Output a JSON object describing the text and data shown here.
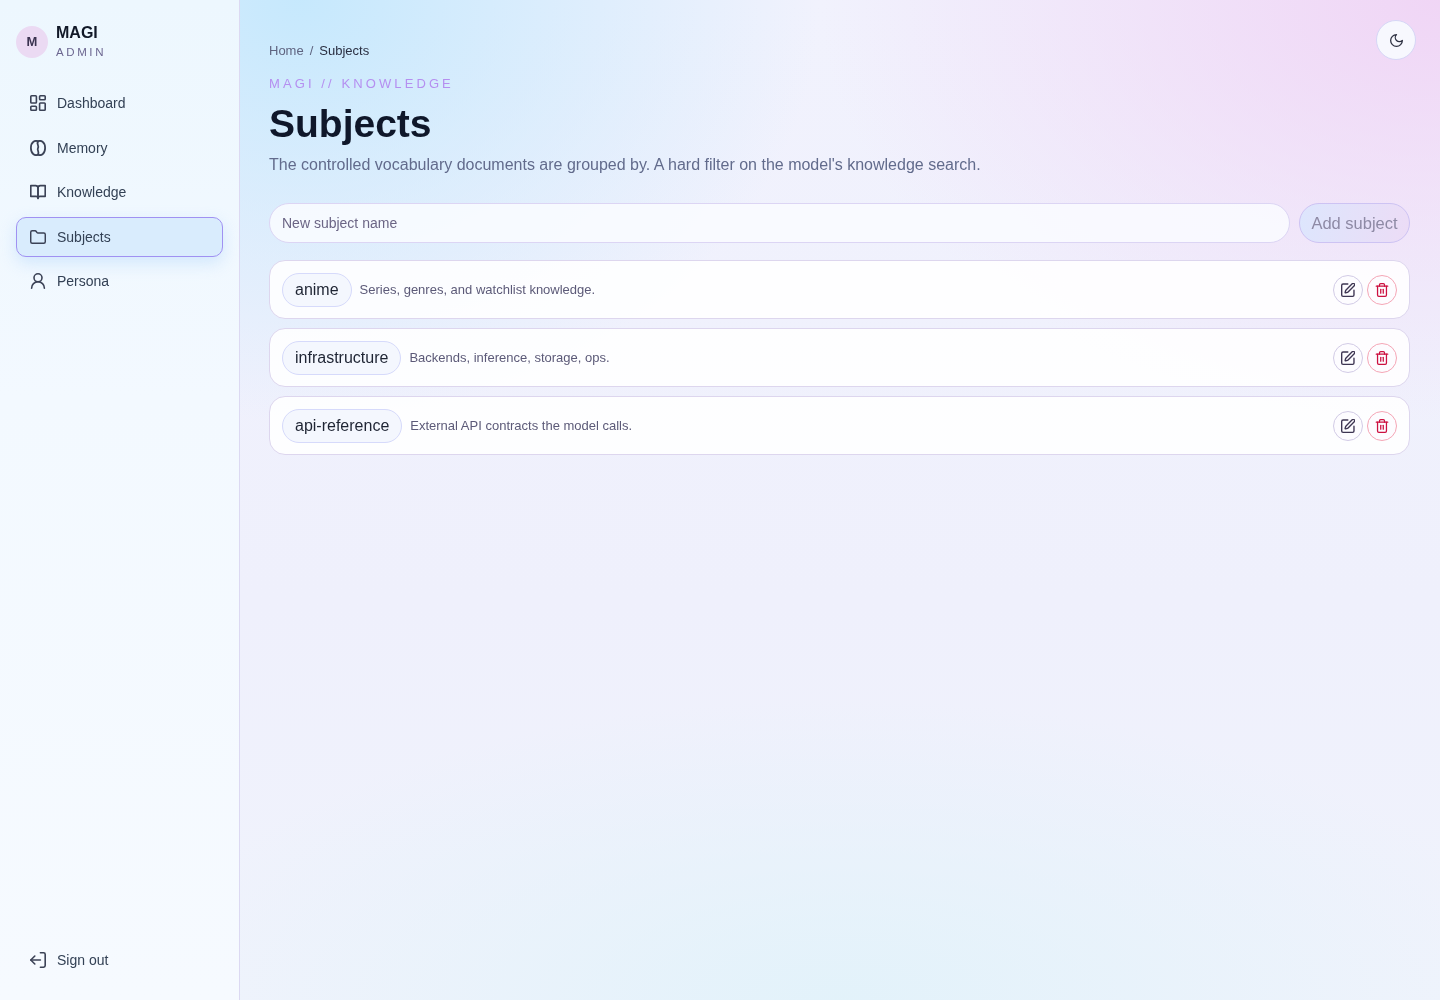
{
  "sidebar": {
    "brand": {
      "initial": "M",
      "name": "MAGI",
      "subtitle": "ADMIN"
    },
    "items": [
      {
        "label": "Dashboard",
        "selected": false
      },
      {
        "label": "Memory",
        "selected": false
      },
      {
        "label": "Knowledge",
        "selected": false
      },
      {
        "label": "Subjects",
        "selected": true
      },
      {
        "label": "Persona",
        "selected": false
      }
    ],
    "sign_out": "Sign out"
  },
  "header": {
    "breadcrumb": [
      {
        "label": "Home",
        "current": false
      },
      {
        "label": "Subjects",
        "current": true
      }
    ],
    "separator": "/",
    "eyebrow": "MAGI // KNOWLEDGE",
    "title": "Subjects",
    "description": "The controlled vocabulary documents are grouped by. A hard filter on the model's knowledge search."
  },
  "add_form": {
    "placeholder": "New subject name",
    "button": {
      "label": "Add subject",
      "disabled": true
    }
  },
  "subjects": [
    {
      "name": "anime",
      "description": "Series, genres, and watchlist knowledge."
    },
    {
      "name": "infrastructure",
      "description": "Backends, inference, storage, ops."
    },
    {
      "name": "api-reference",
      "description": "External API contracts the model calls."
    }
  ]
}
